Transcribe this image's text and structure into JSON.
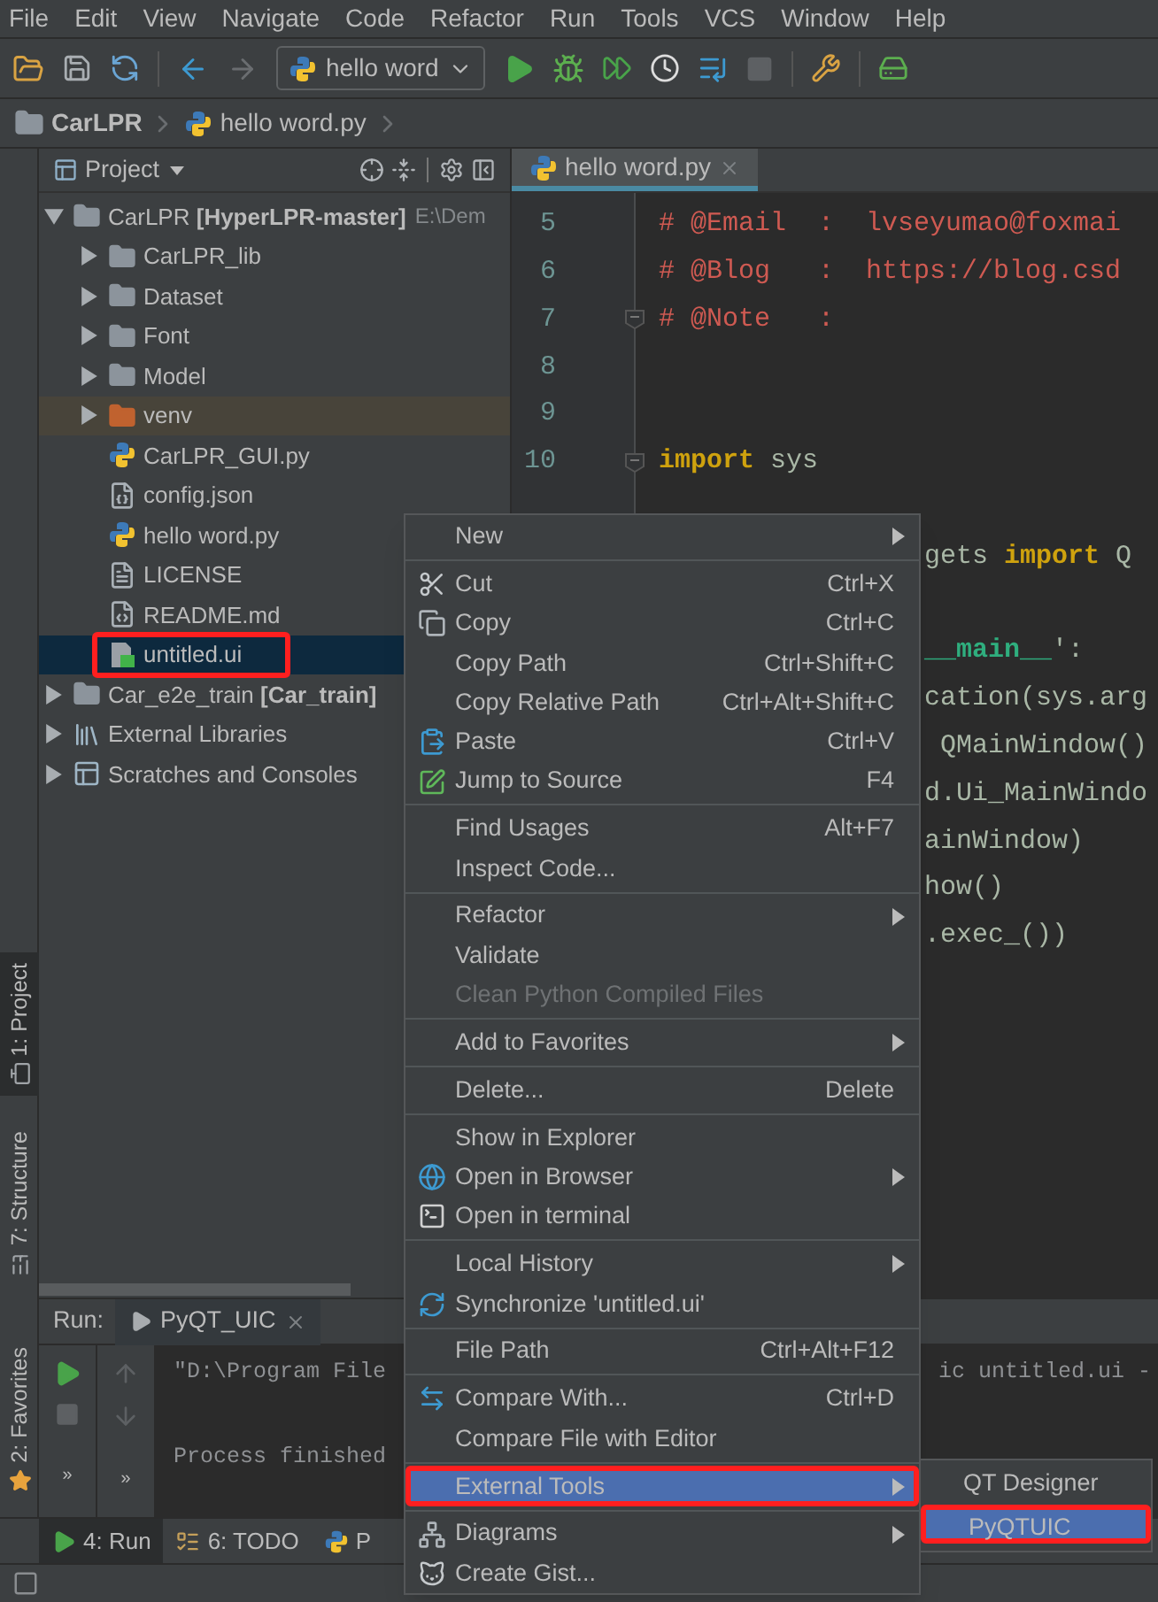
{
  "menu_bar": [
    "File",
    "Edit",
    "View",
    "Navigate",
    "Code",
    "Refactor",
    "Run",
    "Tools",
    "VCS",
    "Window",
    "Help"
  ],
  "toolbar": {
    "run_config": "hello word"
  },
  "breadcrumb": [
    "CarLPR",
    "hello word.py"
  ],
  "left_stripe": [
    {
      "label": "1: Project",
      "kind": "project",
      "selected": true
    },
    {
      "label": "7: Structure",
      "kind": "structure",
      "selected": false
    },
    {
      "label": "2: Favorites",
      "kind": "favorites",
      "selected": false
    }
  ],
  "project_panel": {
    "title": "Project",
    "tree": [
      {
        "label": "CarLPR **[HyperLPR-master]**",
        "detail": "E:\\Dem",
        "kind": "module",
        "expanded": true,
        "selected": false,
        "outlined": false,
        "children": [
          {
            "label": "CarLPR_lib",
            "kind": "folder",
            "expanded": false,
            "selected": false,
            "outlined": false
          },
          {
            "label": "Dataset",
            "kind": "folder",
            "expanded": false,
            "selected": false,
            "outlined": false
          },
          {
            "label": "Font",
            "kind": "folder",
            "expanded": false,
            "selected": false,
            "outlined": false
          },
          {
            "label": "Model",
            "kind": "folder",
            "expanded": false,
            "selected": false,
            "outlined": false
          },
          {
            "label": "venv",
            "kind": "excluded",
            "expanded": false,
            "selected": false,
            "outlined": false
          },
          {
            "label": "CarLPR_GUI.py",
            "kind": "python",
            "selected": false,
            "outlined": false
          },
          {
            "label": "config.json",
            "kind": "json",
            "selected": false,
            "outlined": false
          },
          {
            "label": "hello word.py",
            "kind": "python",
            "selected": false,
            "outlined": false
          },
          {
            "label": "LICENSE",
            "kind": "text",
            "selected": false,
            "outlined": false
          },
          {
            "label": "README.md",
            "kind": "markdown",
            "selected": false,
            "outlined": false
          },
          {
            "label": "untitled.ui",
            "kind": "ui",
            "selected": true,
            "outlined": true
          }
        ]
      },
      {
        "label": "Car_e2e_train **[Car_train]**",
        "kind": "module",
        "expanded": false,
        "selected": false,
        "outlined": false
      },
      {
        "label": "External Libraries",
        "kind": "libraries",
        "expanded": false,
        "selected": false,
        "outlined": false
      },
      {
        "label": "Scratches and Consoles",
        "kind": "scratches",
        "expanded": false,
        "selected": false,
        "outlined": false
      }
    ]
  },
  "editor": {
    "tabs": [
      {
        "label": "hello word.py",
        "selected": true
      }
    ],
    "lines": [
      {
        "kind": "line",
        "number": "5",
        "fold": false,
        "tokens": [
          {
            "kind": "comment",
            "text": "# @Email  :  lvseyumao@foxmai"
          }
        ]
      },
      {
        "kind": "line",
        "number": "6",
        "fold": false,
        "tokens": [
          {
            "kind": "comment",
            "text": "# @Blog   :  https://blog.csd"
          }
        ]
      },
      {
        "kind": "line",
        "number": "7",
        "fold": true,
        "tokens": [
          {
            "kind": "comment",
            "text": "# @Note   :"
          }
        ]
      },
      {
        "kind": "line",
        "number": "8",
        "fold": false
      },
      {
        "kind": "line",
        "number": "9",
        "fold": false
      },
      {
        "kind": "line",
        "number": "10",
        "fold": true,
        "tokens": [
          {
            "kind": "keyword",
            "text": "import"
          },
          {
            "kind": "plain",
            "text": " sys"
          }
        ]
      },
      {
        "kind": "fragment"
      },
      {
        "kind": "fragment",
        "tokens": [
          {
            "kind": "plain",
            "text": "gets "
          },
          {
            "kind": "keyword",
            "text": "import"
          },
          {
            "kind": "plain",
            "text": " Q"
          }
        ]
      },
      {
        "kind": "fragment"
      },
      {
        "kind": "fragment",
        "tokens": [
          {
            "kind": "special",
            "text": "__main__"
          },
          {
            "kind": "plain",
            "text": "':"
          }
        ]
      },
      {
        "kind": "fragment",
        "tokens": [
          {
            "kind": "plain",
            "text": "cation(sys.arg"
          }
        ]
      },
      {
        "kind": "fragment",
        "tokens": [
          {
            "kind": "plain",
            "text": " QMainWindow()"
          }
        ]
      },
      {
        "kind": "fragment",
        "tokens": [
          {
            "kind": "plain",
            "text": "d.Ui_MainWindo"
          }
        ]
      },
      {
        "kind": "fragment",
        "tokens": [
          {
            "kind": "plain",
            "text": "ainWindow)"
          }
        ]
      },
      {
        "kind": "fragment",
        "tokens": [
          {
            "kind": "plain",
            "text": "how()"
          }
        ]
      },
      {
        "kind": "fragment",
        "tokens": [
          {
            "kind": "plain",
            "text": ".exec_())"
          }
        ]
      }
    ]
  },
  "run_panel": {
    "label": "Run:",
    "tabs": [
      {
        "label": "PyQT_UIC",
        "selected": true
      }
    ],
    "command": {
      "text": "\"D:\\Program File",
      "tail": "ic untitled.ui -"
    },
    "result": "Process finished",
    "more": [
      "»",
      "»"
    ]
  },
  "bottom_bar": [
    {
      "label": "4: Run",
      "kind": "run",
      "selected": true
    },
    {
      "label": "6: TODO",
      "kind": "todo",
      "selected": false
    },
    {
      "label": "P",
      "kind": "python",
      "selected": false
    }
  ],
  "context_menu": {
    "items": [
      {
        "kind": "plain",
        "label": "New",
        "submenu": true,
        "disabled": false,
        "selected": false,
        "outlined": false
      },
      {
        "kind": "separator"
      },
      {
        "kind": "cut",
        "label": "Cut",
        "shortcut": "Ctrl+X",
        "submenu": false,
        "disabled": false,
        "selected": false,
        "outlined": false
      },
      {
        "kind": "copy",
        "label": "Copy",
        "shortcut": "Ctrl+C",
        "submenu": false,
        "disabled": false,
        "selected": false,
        "outlined": false
      },
      {
        "kind": "plain",
        "label": "Copy Path",
        "shortcut": "Ctrl+Shift+C",
        "submenu": false,
        "disabled": false,
        "selected": false,
        "outlined": false
      },
      {
        "kind": "plain",
        "label": "Copy Relative Path",
        "shortcut": "Ctrl+Alt+Shift+C",
        "submenu": false,
        "disabled": false,
        "selected": false,
        "outlined": false
      },
      {
        "kind": "paste",
        "label": "Paste",
        "shortcut": "Ctrl+V",
        "submenu": false,
        "disabled": false,
        "selected": false,
        "outlined": false
      },
      {
        "kind": "jump",
        "label": "Jump to Source",
        "shortcut": "F4",
        "submenu": false,
        "disabled": false,
        "selected": false,
        "outlined": false
      },
      {
        "kind": "separator"
      },
      {
        "kind": "plain",
        "label": "Find Usages",
        "shortcut": "Alt+F7",
        "submenu": false,
        "disabled": false,
        "selected": false,
        "outlined": false
      },
      {
        "kind": "plain",
        "label": "Inspect Code...",
        "submenu": false,
        "disabled": false,
        "selected": false,
        "outlined": false
      },
      {
        "kind": "separator"
      },
      {
        "kind": "plain",
        "label": "Refactor",
        "submenu": true,
        "disabled": false,
        "selected": false,
        "outlined": false
      },
      {
        "kind": "plain",
        "label": "Validate",
        "submenu": false,
        "disabled": false,
        "selected": false,
        "outlined": false
      },
      {
        "kind": "plain",
        "label": "Clean Python Compiled Files",
        "submenu": false,
        "disabled": true,
        "selected": false,
        "outlined": false
      },
      {
        "kind": "separator"
      },
      {
        "kind": "plain",
        "label": "Add to Favorites",
        "submenu": true,
        "disabled": false,
        "selected": false,
        "outlined": false
      },
      {
        "kind": "separator"
      },
      {
        "kind": "plain",
        "label": "Delete...",
        "shortcut": "Delete",
        "submenu": false,
        "disabled": false,
        "selected": false,
        "outlined": false
      },
      {
        "kind": "separator"
      },
      {
        "kind": "plain",
        "label": "Show in Explorer",
        "submenu": false,
        "disabled": false,
        "selected": false,
        "outlined": false
      },
      {
        "kind": "globe",
        "label": "Open in Browser",
        "submenu": true,
        "disabled": false,
        "selected": false,
        "outlined": false
      },
      {
        "kind": "terminal",
        "label": "Open in terminal",
        "submenu": false,
        "disabled": false,
        "selected": false,
        "outlined": false
      },
      {
        "kind": "separator"
      },
      {
        "kind": "plain",
        "label": "Local History",
        "submenu": true,
        "disabled": false,
        "selected": false,
        "outlined": false
      },
      {
        "kind": "sync",
        "label": "Synchronize 'untitled.ui'",
        "submenu": false,
        "disabled": false,
        "selected": false,
        "outlined": false
      },
      {
        "kind": "separator"
      },
      {
        "kind": "plain",
        "label": "File Path",
        "shortcut": "Ctrl+Alt+F12",
        "submenu": false,
        "disabled": false,
        "selected": false,
        "outlined": false
      },
      {
        "kind": "separator"
      },
      {
        "kind": "compare",
        "label": "Compare With...",
        "shortcut": "Ctrl+D",
        "submenu": false,
        "disabled": false,
        "selected": false,
        "outlined": false
      },
      {
        "kind": "plain",
        "label": "Compare File with Editor",
        "submenu": false,
        "disabled": false,
        "selected": false,
        "outlined": false
      },
      {
        "kind": "separator"
      },
      {
        "kind": "plain",
        "label": "External Tools",
        "submenu": true,
        "disabled": false,
        "selected": true,
        "outlined": true,
        "children": [
          {
            "label": "QT Designer",
            "selected": false,
            "outlined": false
          },
          {
            "label": "PyQTUIC",
            "selected": true,
            "outlined": true
          }
        ]
      },
      {
        "kind": "separator"
      },
      {
        "kind": "diagram",
        "label": "Diagrams",
        "submenu": true,
        "disabled": false,
        "selected": false,
        "outlined": false
      },
      {
        "kind": "cat",
        "label": "Create Gist...",
        "submenu": false,
        "disabled": false,
        "selected": false,
        "outlined": false
      }
    ]
  }
}
